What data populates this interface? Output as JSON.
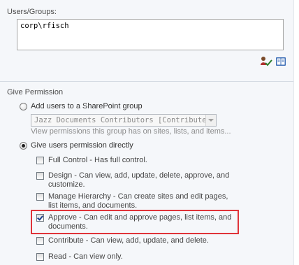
{
  "users_groups": {
    "label": "Users/Groups:",
    "value": "corp\\rfisch",
    "check_names_icon": "check-names-icon",
    "browse_icon": "address-book-icon"
  },
  "give_permission": {
    "heading": "Give Permission",
    "option_group": {
      "label": "Add users to a SharePoint group",
      "selected_group": "Jazz Documents Contributors [Contribute]",
      "hint": "View permissions this group has on sites, lists, and items..."
    },
    "option_direct": {
      "label": "Give users permission directly"
    },
    "permissions": [
      {
        "label": "Full Control - Has full control.",
        "checked": false
      },
      {
        "label": "Design - Can view, add, update, delete, approve, and customize.",
        "checked": false
      },
      {
        "label": "Manage Hierarchy - Can create sites and edit pages, list items, and documents.",
        "checked": false
      },
      {
        "label": "Approve - Can edit and approve pages, list items, and documents.",
        "checked": true
      },
      {
        "label": "Contribute - Can view, add, update, and delete.",
        "checked": false
      },
      {
        "label": "Read - Can view only.",
        "checked": false
      }
    ],
    "highlight_color": "#e03339"
  }
}
